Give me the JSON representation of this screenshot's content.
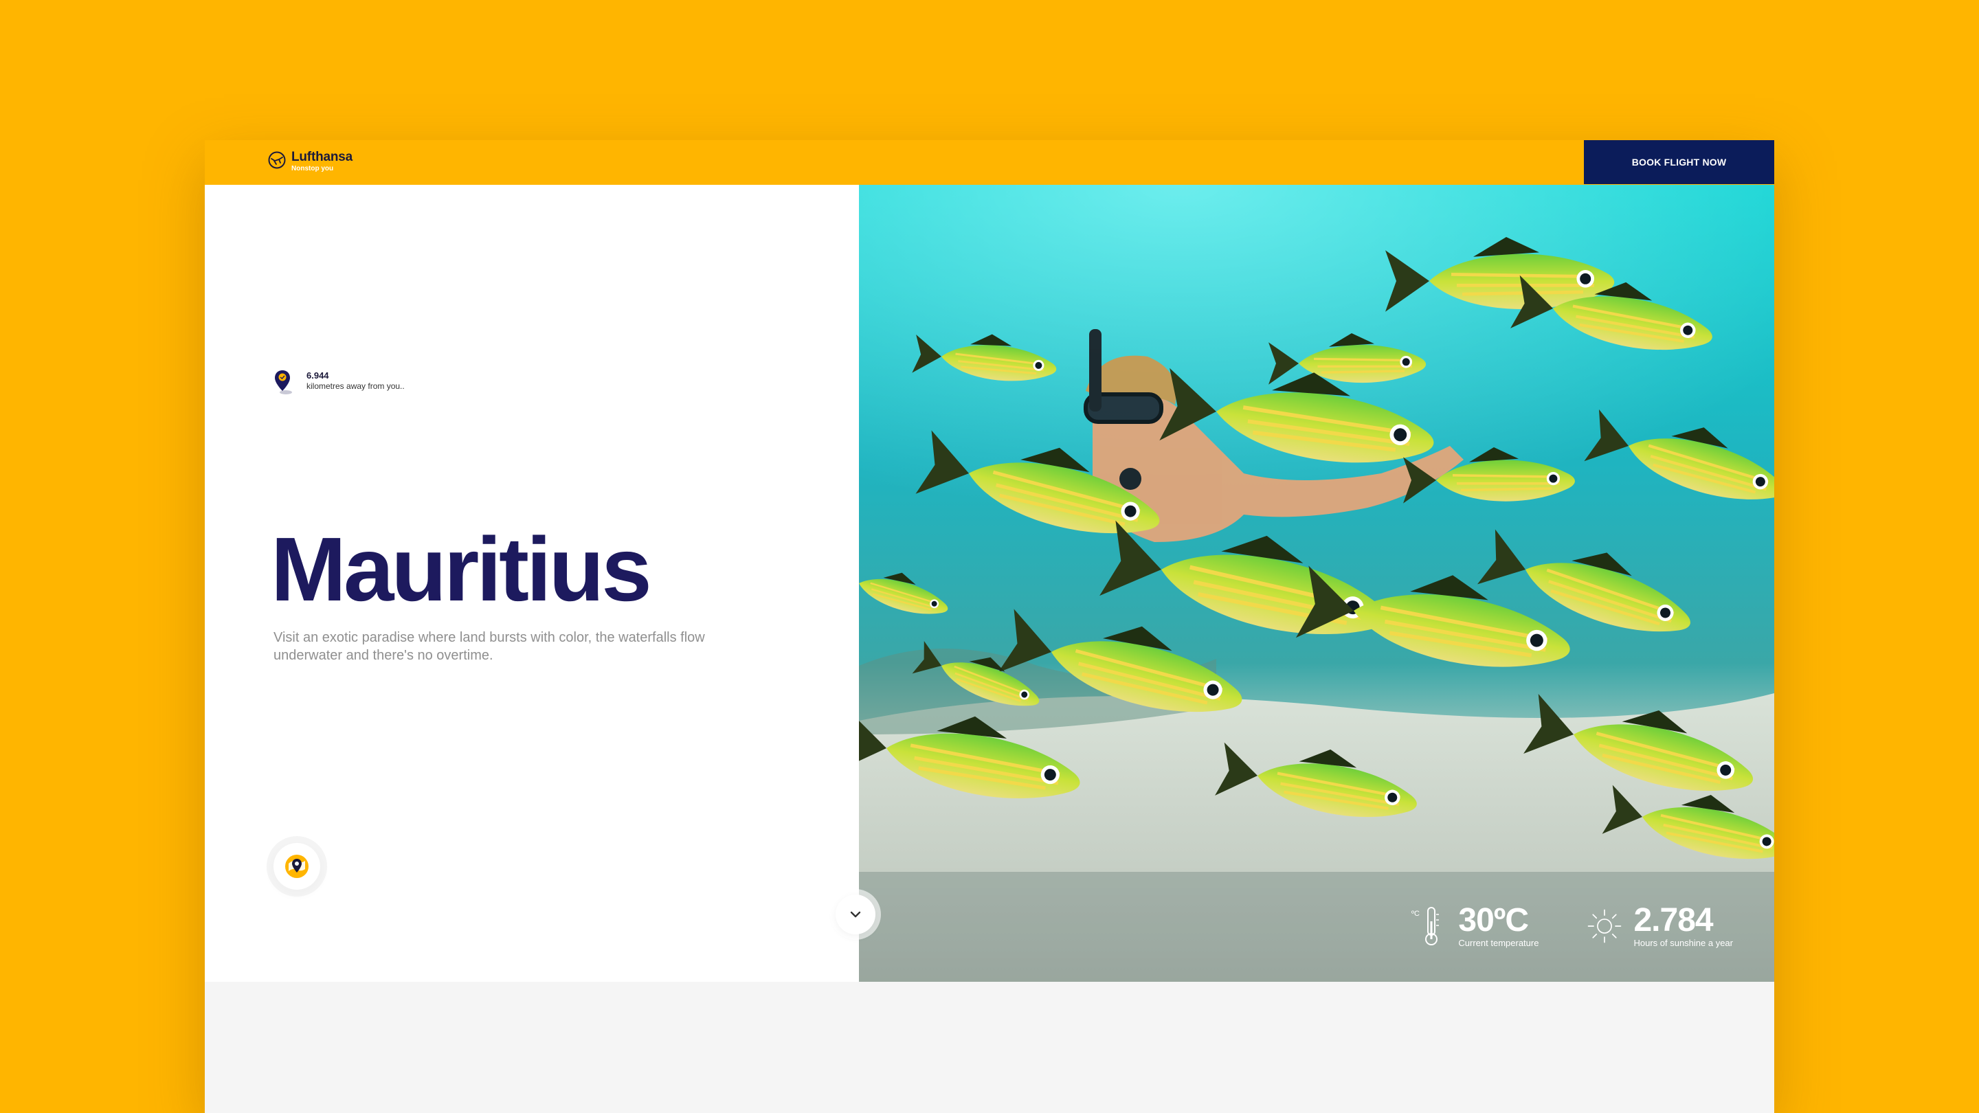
{
  "brand": {
    "name": "Lufthansa",
    "tagline": "Nonstop you"
  },
  "header": {
    "book_label": "BOOK FLIGHT NOW"
  },
  "distance": {
    "value": "6.944",
    "label": "kilometres away from you.."
  },
  "destination": {
    "title": "Mauritius",
    "description": "Visit an exotic paradise where land bursts with color, the waterfalls flow underwater and there's no overtime."
  },
  "stats": [
    {
      "value": "30ºC",
      "label": "Current temperature",
      "icon": "thermometer-icon",
      "unit_badge": "ºC"
    },
    {
      "value": "2.784",
      "label": "Hours of sunshine a year",
      "icon": "sun-icon"
    }
  ],
  "colors": {
    "background": "#FFB500",
    "navy": "#0B1C5A",
    "title": "#1d1a5e"
  },
  "icons": {
    "scroll": "chevron-down-icon",
    "map": "map-pin-icon"
  }
}
